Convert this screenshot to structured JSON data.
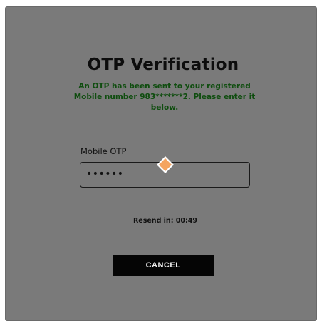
{
  "modal": {
    "title": "OTP Verification",
    "message": "An OTP has been sent to your registered Mobile number 983*******2. Please enter it below.",
    "otp_label": "Mobile OTP",
    "otp_value": "••••••",
    "resend_text": "Resend in: 00:49",
    "cancel_label": "CANCEL"
  },
  "cursor_icon": "orange-diamond-cursor-icon",
  "colors": {
    "overlay": "#7a7a7a",
    "message_text": "#0f4d0f",
    "button_bg": "#050505",
    "cursor": "#f4a460"
  }
}
